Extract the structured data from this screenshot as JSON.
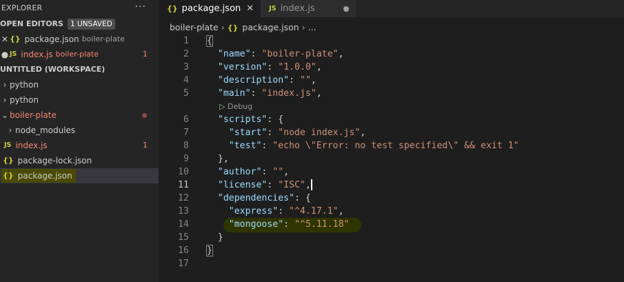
{
  "sidebar": {
    "title": "EXPLORER",
    "more": "···",
    "open_editors_label": "OPEN EDITORS",
    "unsaved_badge": "1 UNSAVED",
    "open_editors": [
      {
        "name": "package.json",
        "desc": "boiler-plate"
      },
      {
        "name": "index.js",
        "desc": "boiler-plate",
        "problems": "1"
      }
    ],
    "workspace_label": "UNTITLED (WORKSPACE)",
    "tree": [
      {
        "label": "python"
      },
      {
        "label": "python"
      },
      {
        "label": "boiler-plate"
      },
      {
        "label": "node_modules"
      },
      {
        "label": "index.js",
        "problems": "1"
      },
      {
        "label": "package-lock.json"
      },
      {
        "label": "package.json"
      }
    ]
  },
  "tabs": [
    {
      "label": "package.json"
    },
    {
      "label": "index.js"
    }
  ],
  "breadcrumb": {
    "folder": "boiler-plate",
    "file": "package.json",
    "more": "..."
  },
  "codelens": "Debug",
  "line_numbers": [
    "1",
    "2",
    "3",
    "4",
    "5",
    "6",
    "7",
    "8",
    "9",
    "10",
    "11",
    "12",
    "13",
    "14",
    "15",
    "16",
    "17"
  ],
  "code": {
    "l1": "{",
    "name_k": "\"name\"",
    "name_v": "\"boiler-plate\"",
    "version_k": "\"version\"",
    "version_v": "\"1.0.0\"",
    "desc_k": "\"description\"",
    "desc_v": "\"\"",
    "main_k": "\"main\"",
    "main_v": "\"index.js\"",
    "scripts_k": "\"scripts\"",
    "start_k": "\"start\"",
    "start_v": "\"node index.js\"",
    "test_k": "\"test\"",
    "test_v": "\"echo \\\"Error: no test specified\\\" && exit 1\"",
    "close_scripts": "},",
    "author_k": "\"author\"",
    "author_v": "\"\"",
    "license_k": "\"license\"",
    "license_v": "\"ISC\"",
    "deps_k": "\"dependencies\"",
    "express_k": "\"express\"",
    "express_v": "\"^4.17.1\"",
    "mongoose_k": "\"mongoose\"",
    "mongoose_v": "\"^5.11.18\"",
    "close_deps": "}",
    "l16": "}"
  }
}
